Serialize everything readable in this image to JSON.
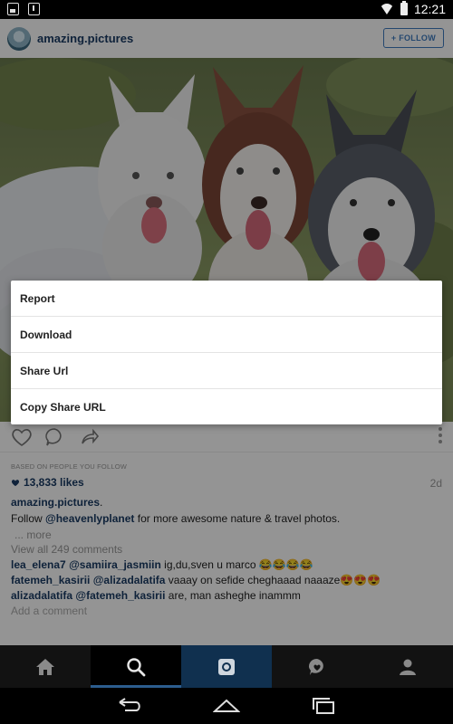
{
  "status_bar": {
    "time": "12:21"
  },
  "post": {
    "username": "amazing.pictures",
    "follow_label": "+ FOLLOW",
    "based_on": "BASED ON PEOPLE YOU FOLLOW",
    "likes": "13,833 likes",
    "time_ago": "2d",
    "caption_user": "amazing.pictures",
    "caption_dot": ".",
    "caption_prefix": "Follow ",
    "caption_mention": "@heavenlyplanet",
    "caption_suffix": " for more awesome nature & travel photos.",
    "more": "... more",
    "view_all": "View all 249 comments",
    "comments": [
      {
        "user": "lea_elena7",
        "mention": "@samiira_jasmiin",
        "text": " ig,du,sven u marco 😂😂😂😂"
      },
      {
        "user": "fatemeh_kasirii",
        "mention": "@alizadalatifa",
        "text": " vaaay on sefide cheghaaad naaaze😍😍😍"
      },
      {
        "user": "alizadalatifa",
        "mention": "@fatemeh_kasirii",
        "text": " are, man asheghe inammm"
      }
    ],
    "add_comment": "Add a comment"
  },
  "dialog": {
    "items": [
      "Report",
      "Download",
      "Share Url",
      "Copy Share URL"
    ]
  },
  "colors": {
    "accent": "#1a3c64",
    "follow": "#3f7bbf",
    "tab_active": "#2c5d8e"
  },
  "icons": {
    "tabs": [
      "home-icon",
      "search-icon",
      "camera-icon",
      "activity-icon",
      "profile-icon"
    ],
    "nav": [
      "back-icon",
      "home-nav-icon",
      "recents-icon"
    ]
  }
}
